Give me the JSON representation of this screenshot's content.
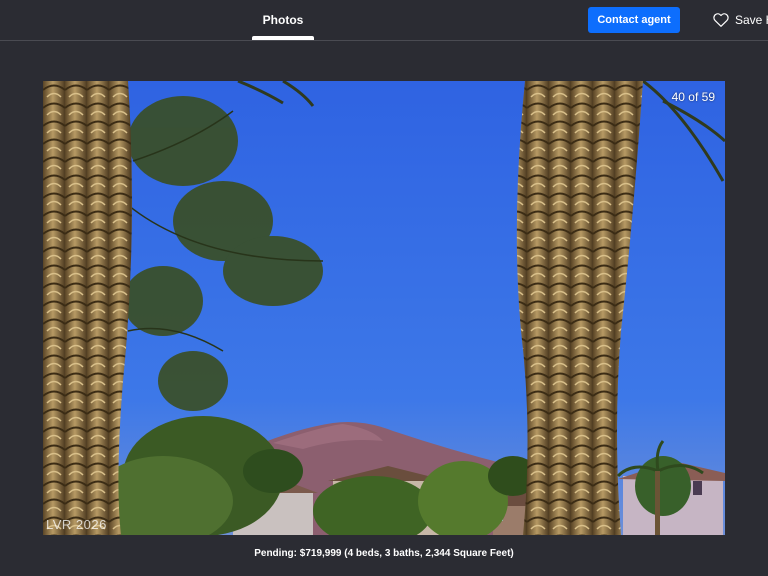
{
  "header": {
    "tabs": [
      {
        "label": "Photos",
        "active": true
      }
    ],
    "contact_button": "Contact agent",
    "save_button": "Save H"
  },
  "photo": {
    "counter": "40 of 59",
    "watermark": "LVR 2026",
    "current_index": 40,
    "total": 59,
    "sky_color": "#3a6ee0"
  },
  "caption": "Pending: $719,999 (4 beds, 3 baths, 2,344 Square Feet)",
  "colors": {
    "background": "#2b2c33",
    "accent": "#0d6efd",
    "text": "#ffffff"
  }
}
